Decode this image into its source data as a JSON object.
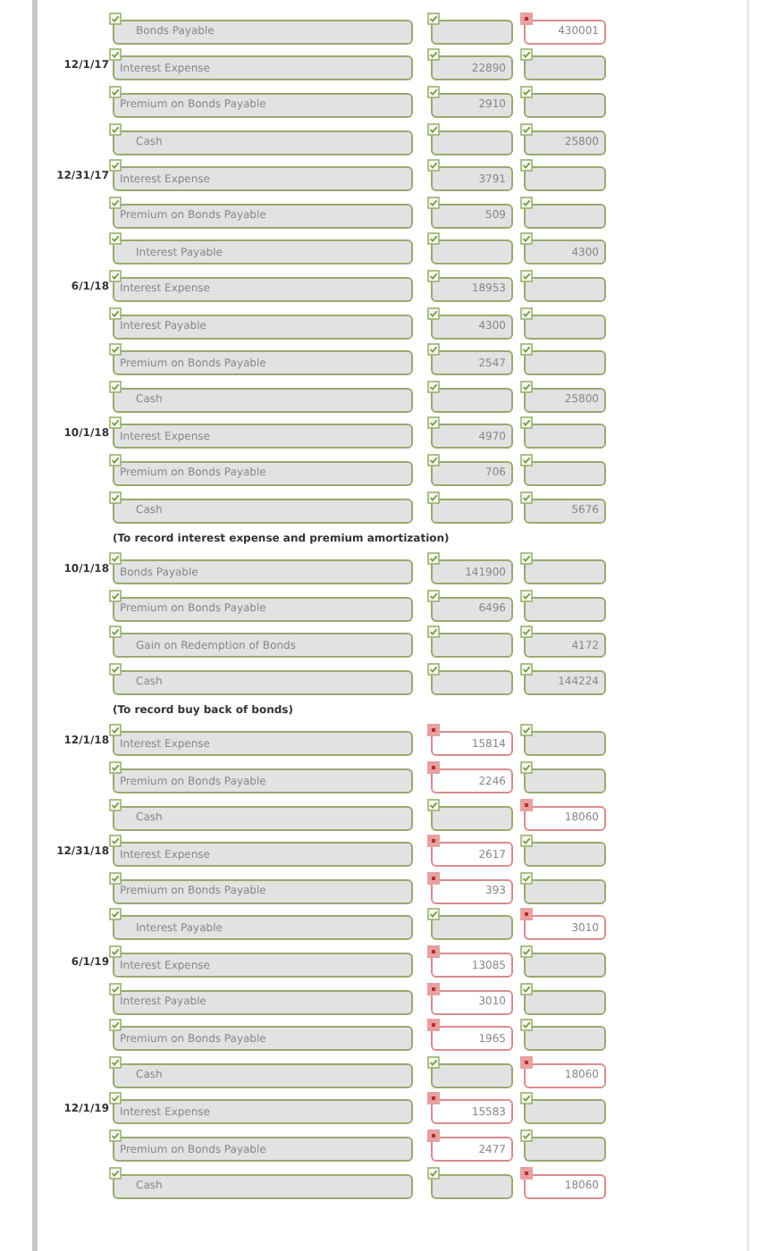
{
  "entries": [
    {
      "kind": "line",
      "indented": true,
      "account": {
        "text": "Bonds Payable",
        "correct": true
      },
      "debit": {
        "correct": true
      },
      "credit": {
        "value": "430001",
        "correct": false
      }
    },
    {
      "kind": "line",
      "date": "12/1/17",
      "indented": false,
      "account": {
        "text": "Interest Expense",
        "correct": true
      },
      "debit": {
        "value": "22890",
        "correct": true
      },
      "credit": {
        "correct": true
      }
    },
    {
      "kind": "line",
      "indented": false,
      "account": {
        "text": "Premium on Bonds Payable",
        "correct": true
      },
      "debit": {
        "value": "2910",
        "correct": true
      },
      "credit": {
        "correct": true
      }
    },
    {
      "kind": "line",
      "indented": true,
      "account": {
        "text": "Cash",
        "correct": true
      },
      "debit": {
        "correct": true
      },
      "credit": {
        "value": "25800",
        "correct": true
      }
    },
    {
      "kind": "line",
      "date": "12/31/17",
      "indented": false,
      "account": {
        "text": "Interest Expense",
        "correct": true
      },
      "debit": {
        "value": "3791",
        "correct": true
      },
      "credit": {
        "correct": true
      }
    },
    {
      "kind": "line",
      "indented": false,
      "account": {
        "text": "Premium on Bonds Payable",
        "correct": true
      },
      "debit": {
        "value": "509",
        "correct": true
      },
      "credit": {
        "correct": true
      }
    },
    {
      "kind": "line",
      "indented": true,
      "account": {
        "text": "Interest Payable",
        "correct": true
      },
      "debit": {
        "correct": true
      },
      "credit": {
        "value": "4300",
        "correct": true
      }
    },
    {
      "kind": "line",
      "date": "6/1/18",
      "indented": false,
      "account": {
        "text": "Interest Expense",
        "correct": true
      },
      "debit": {
        "value": "18953",
        "correct": true
      },
      "credit": {
        "correct": true
      }
    },
    {
      "kind": "line",
      "indented": false,
      "account": {
        "text": "Interest Payable",
        "correct": true
      },
      "debit": {
        "value": "4300",
        "correct": true
      },
      "credit": {
        "correct": true
      }
    },
    {
      "kind": "line",
      "indented": false,
      "account": {
        "text": "Premium on Bonds Payable",
        "correct": true
      },
      "debit": {
        "value": "2547",
        "correct": true
      },
      "credit": {
        "correct": true
      }
    },
    {
      "kind": "line",
      "indented": true,
      "account": {
        "text": "Cash",
        "correct": true
      },
      "debit": {
        "correct": true
      },
      "credit": {
        "value": "25800",
        "correct": true
      }
    },
    {
      "kind": "line",
      "date": "10/1/18",
      "indented": false,
      "account": {
        "text": "Interest Expense",
        "correct": true
      },
      "debit": {
        "value": "4970",
        "correct": true
      },
      "credit": {
        "correct": true
      }
    },
    {
      "kind": "line",
      "indented": false,
      "account": {
        "text": "Premium on Bonds Payable",
        "correct": true
      },
      "debit": {
        "value": "706",
        "correct": true
      },
      "credit": {
        "correct": true
      }
    },
    {
      "kind": "line",
      "indented": true,
      "account": {
        "text": "Cash",
        "correct": true
      },
      "debit": {
        "correct": true
      },
      "credit": {
        "value": "5676",
        "correct": true
      }
    },
    {
      "kind": "note",
      "text": "(To record interest expense and premium amortization)"
    },
    {
      "kind": "line",
      "date": "10/1/18",
      "indented": false,
      "account": {
        "text": "Bonds Payable",
        "correct": true
      },
      "debit": {
        "value": "141900",
        "correct": true
      },
      "credit": {
        "correct": true
      }
    },
    {
      "kind": "line",
      "indented": false,
      "account": {
        "text": "Premium on Bonds Payable",
        "correct": true
      },
      "debit": {
        "value": "6496",
        "correct": true
      },
      "credit": {
        "correct": true
      }
    },
    {
      "kind": "line",
      "indented": true,
      "account": {
        "text": "Gain on Redemption of Bonds",
        "correct": true
      },
      "debit": {
        "correct": true
      },
      "credit": {
        "value": "4172",
        "correct": true
      }
    },
    {
      "kind": "line",
      "indented": true,
      "account": {
        "text": "Cash",
        "correct": true
      },
      "debit": {
        "correct": true
      },
      "credit": {
        "value": "144224",
        "correct": true
      }
    },
    {
      "kind": "note",
      "text": "(To record buy back of bonds)"
    },
    {
      "kind": "line",
      "date": "12/1/18",
      "indented": false,
      "account": {
        "text": "Interest Expense",
        "correct": true
      },
      "debit": {
        "value": "15814",
        "correct": false
      },
      "credit": {
        "correct": true
      }
    },
    {
      "kind": "line",
      "indented": false,
      "account": {
        "text": "Premium on Bonds Payable",
        "correct": true
      },
      "debit": {
        "value": "2246",
        "correct": false
      },
      "credit": {
        "correct": true
      }
    },
    {
      "kind": "line",
      "indented": true,
      "account": {
        "text": "Cash",
        "correct": true
      },
      "debit": {
        "correct": true
      },
      "credit": {
        "value": "18060",
        "correct": false
      }
    },
    {
      "kind": "line",
      "date": "12/31/18",
      "indented": false,
      "account": {
        "text": "Interest Expense",
        "correct": true
      },
      "debit": {
        "value": "2617",
        "correct": false
      },
      "credit": {
        "correct": true
      }
    },
    {
      "kind": "line",
      "indented": false,
      "account": {
        "text": "Premium on Bonds Payable",
        "correct": true
      },
      "debit": {
        "value": "393",
        "correct": false
      },
      "credit": {
        "correct": true
      }
    },
    {
      "kind": "line",
      "indented": true,
      "account": {
        "text": "Interest Payable",
        "correct": true
      },
      "debit": {
        "correct": true
      },
      "credit": {
        "value": "3010",
        "correct": false
      }
    },
    {
      "kind": "line",
      "date": "6/1/19",
      "indented": false,
      "account": {
        "text": "Interest Expense",
        "correct": true
      },
      "debit": {
        "value": "13085",
        "correct": false
      },
      "credit": {
        "correct": true
      }
    },
    {
      "kind": "line",
      "indented": false,
      "account": {
        "text": "Interest Payable",
        "correct": true
      },
      "debit": {
        "value": "3010",
        "correct": false
      },
      "credit": {
        "correct": true
      }
    },
    {
      "kind": "line",
      "indented": false,
      "account": {
        "text": "Premium on Bonds Payable",
        "correct": true
      },
      "debit": {
        "value": "1965",
        "correct": false
      },
      "credit": {
        "correct": true
      }
    },
    {
      "kind": "line",
      "indented": true,
      "account": {
        "text": "Cash",
        "correct": true
      },
      "debit": {
        "correct": true
      },
      "credit": {
        "value": "18060",
        "correct": false
      }
    },
    {
      "kind": "line",
      "date": "12/1/19",
      "indented": false,
      "account": {
        "text": "Interest Expense",
        "correct": true
      },
      "debit": {
        "value": "15583",
        "correct": false
      },
      "credit": {
        "correct": true
      }
    },
    {
      "kind": "line",
      "indented": false,
      "account": {
        "text": "Premium on Bonds Payable",
        "correct": true
      },
      "debit": {
        "value": "2477",
        "correct": false
      },
      "credit": {
        "correct": true
      }
    },
    {
      "kind": "line",
      "indented": true,
      "account": {
        "text": "Cash",
        "correct": true
      },
      "debit": {
        "correct": true
      },
      "credit": {
        "value": "18060",
        "correct": false
      }
    }
  ]
}
